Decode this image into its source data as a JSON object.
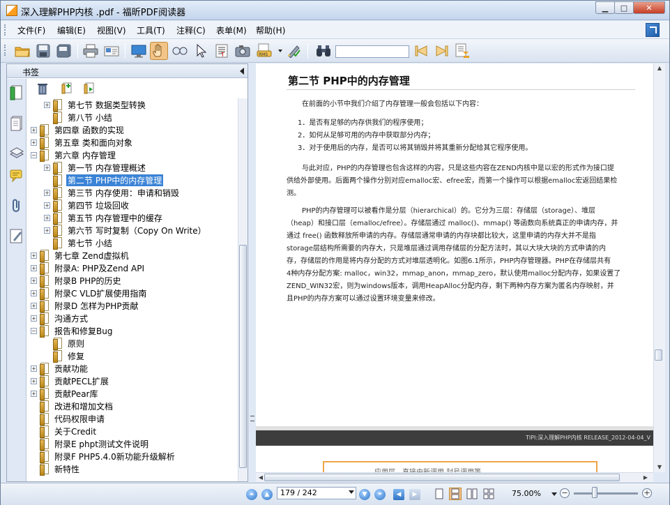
{
  "window": {
    "title": "深入理解PHP内核 .pdf - 福昕PDF阅读器"
  },
  "menu": [
    "文件(F)",
    "编辑(E)",
    "视图(V)",
    "工具(T)",
    "注释(C)",
    "表单(M)",
    "帮助(H)"
  ],
  "toolbar": {
    "search_value": ""
  },
  "sidebar": {
    "title": "书签"
  },
  "bookmarks": [
    {
      "label": "第七节 数据类型转换",
      "expanded": false
    },
    {
      "label": "第八节 小结"
    },
    {
      "label": "第四章 函数的实现",
      "expanded": false
    },
    {
      "label": "第五章 类和面向对象",
      "expanded": false
    },
    {
      "label": "第六章 内存管理",
      "expanded": true
    },
    {
      "label": "第一节 内存管理概述",
      "expanded": false
    },
    {
      "label": "第二节 PHP中的内存管理",
      "selected": true
    },
    {
      "label": "第三节 内存使用：申请和销毁",
      "expanded": false
    },
    {
      "label": "第四节 垃圾回收",
      "expanded": false
    },
    {
      "label": "第五节 内存管理中的缓存",
      "expanded": false
    },
    {
      "label": "第六节 写时复制（Copy On Write）",
      "expanded": false
    },
    {
      "label": "第七节 小结"
    },
    {
      "label": "第七章 Zend虚拟机",
      "expanded": false
    },
    {
      "label": "附录A: PHP及Zend API",
      "expanded": false
    },
    {
      "label": "附录B PHP的历史",
      "expanded": false
    },
    {
      "label": "附录C VLD扩展使用指南",
      "expanded": false
    },
    {
      "label": "附录D 怎样为PHP贡献",
      "expanded": false
    },
    {
      "label": "沟通方式",
      "expanded": false
    },
    {
      "label": "报告和修复Bug",
      "expanded": true
    },
    {
      "label": "原则"
    },
    {
      "label": "修复"
    },
    {
      "label": "贡献功能",
      "expanded": false
    },
    {
      "label": "贡献PECL扩展",
      "expanded": false
    },
    {
      "label": "贡献Pear库",
      "expanded": false
    },
    {
      "label": "改进和增加文档"
    },
    {
      "label": "代码权限申请"
    },
    {
      "label": "关于Credit"
    },
    {
      "label": "附录E phpt测试文件说明"
    },
    {
      "label": "附录F PHP5.4.0新功能升级解析"
    },
    {
      "label": "新特性"
    }
  ],
  "document": {
    "heading": "第二节 PHP中的内存管理",
    "intro": "在前面的小节中我们介绍了内存管理一般会包括以下内容：",
    "list": [
      "1．是否有足够的内存供我们的程序使用；",
      "2．如何从足够可用的内存中获取部分内存；",
      "3．对于使用后的内存，是否可以将其销毁并将其重新分配给其它程序使用。"
    ],
    "para1": [
      "与此对应，PHP的内存管理也包含这样的内容，只是这些内容在ZEND内核中是以宏的形式作为接口提",
      "供给外部使用。后面两个操作分别对应emalloc宏、efree宏，而第一个操作可以根据emalloc宏返回结果检",
      "测。"
    ],
    "para2": [
      "PHP的内存管理可以被看作是分层（hierarchical）的。它分为三层：存储层（storage）、堆层",
      "（heap）和接口层（emalloc/efree）。存储层通过 malloc()、mmap() 等函数向系统真正的申请内存，并",
      "通过 free() 函数释放所申请的内存。存储层通常申请的内存块都比较大，这里申请的内存大并不是指",
      "storage层结构所需要的内存大，只是堆层通过调用存储层的分配方法时，其以大块大块的方式申请的内",
      "存，存储层的作用是将内存分配的方式对堆层透明化。如图6.1所示，PHP内存管理器。PHP在存储层共有",
      "4种内存分配方案: malloc，win32，mmap_anon，mmap_zero，默认使用malloc分配内存，如果设置了",
      "ZEND_WIN32宏，则为windows版本，调用HeapAlloc分配内存，剩下两种内存方案为匿名内存映射，并",
      "且PHP的内存方案可以通过设置环境变量来修改。"
    ],
    "footer": "TIPI:深入理解PHP内核  RELEASE_2012-04-04_V",
    "next_page_partial": "应用层，直接由新调用,封号调用等"
  },
  "status": {
    "page_value": "179 / 242",
    "zoom": "75.00%"
  }
}
